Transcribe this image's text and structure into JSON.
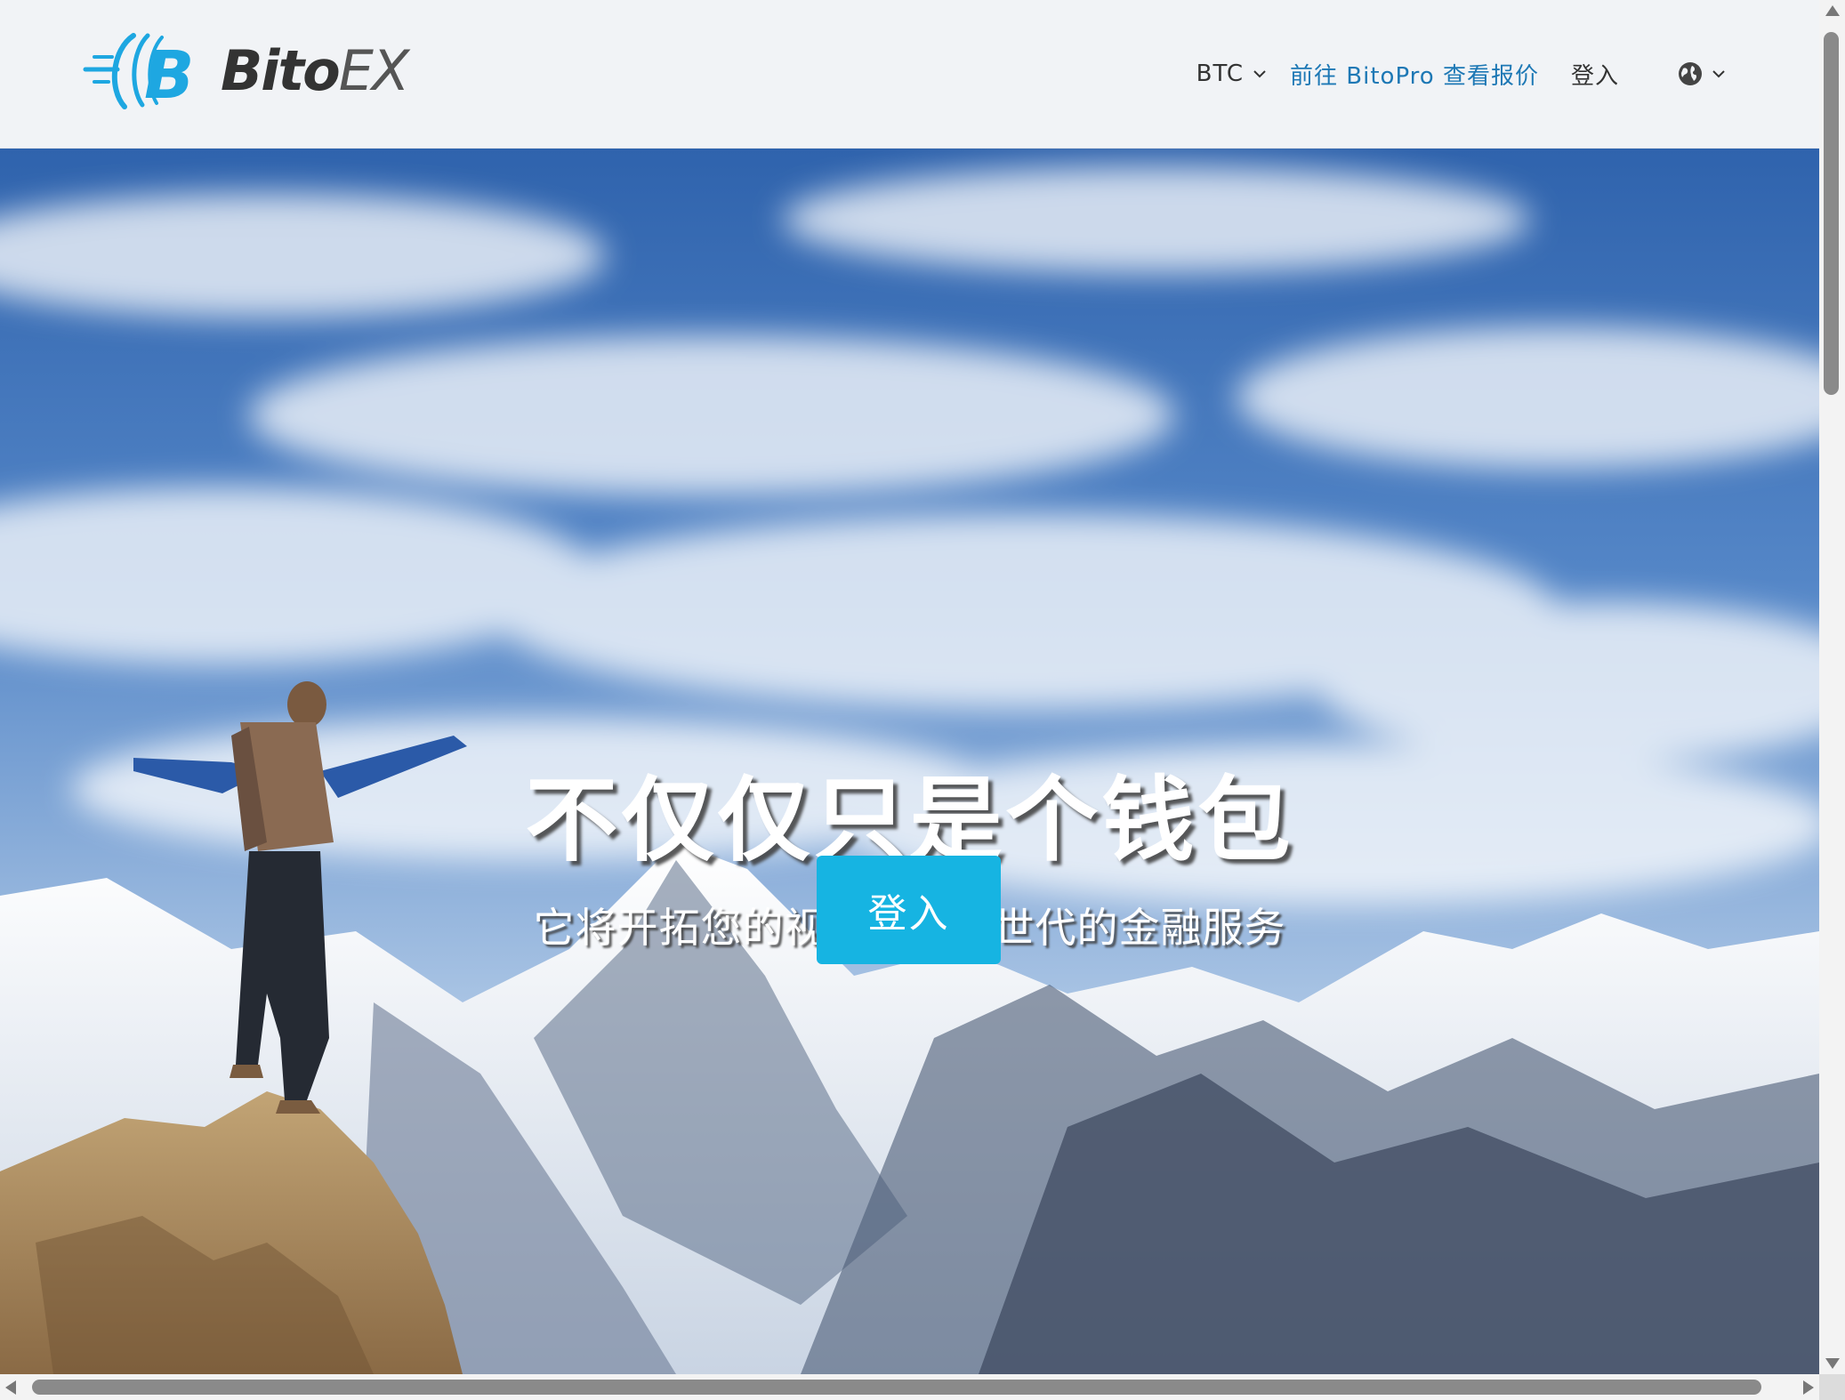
{
  "header": {
    "logo_text_main": "Bito",
    "logo_text_accent": "EX",
    "nav": {
      "coin_label": "BTC",
      "bitopro_link": "前往 BitoPro 查看报价",
      "login_label": "登入"
    },
    "icons": [
      "logo-mark",
      "chevron-down-icon",
      "globe-icon"
    ]
  },
  "hero": {
    "title": "不仅仅只是个钱包",
    "subtitle": "它将开拓您的视野给您新世代的金融服务",
    "cta_label": "登入"
  },
  "colors": {
    "accent_link": "#1d78b5",
    "cta_button": "#16b4e2",
    "logo_blue": "#1ea7e1",
    "header_bg": "#f1f3f6"
  }
}
